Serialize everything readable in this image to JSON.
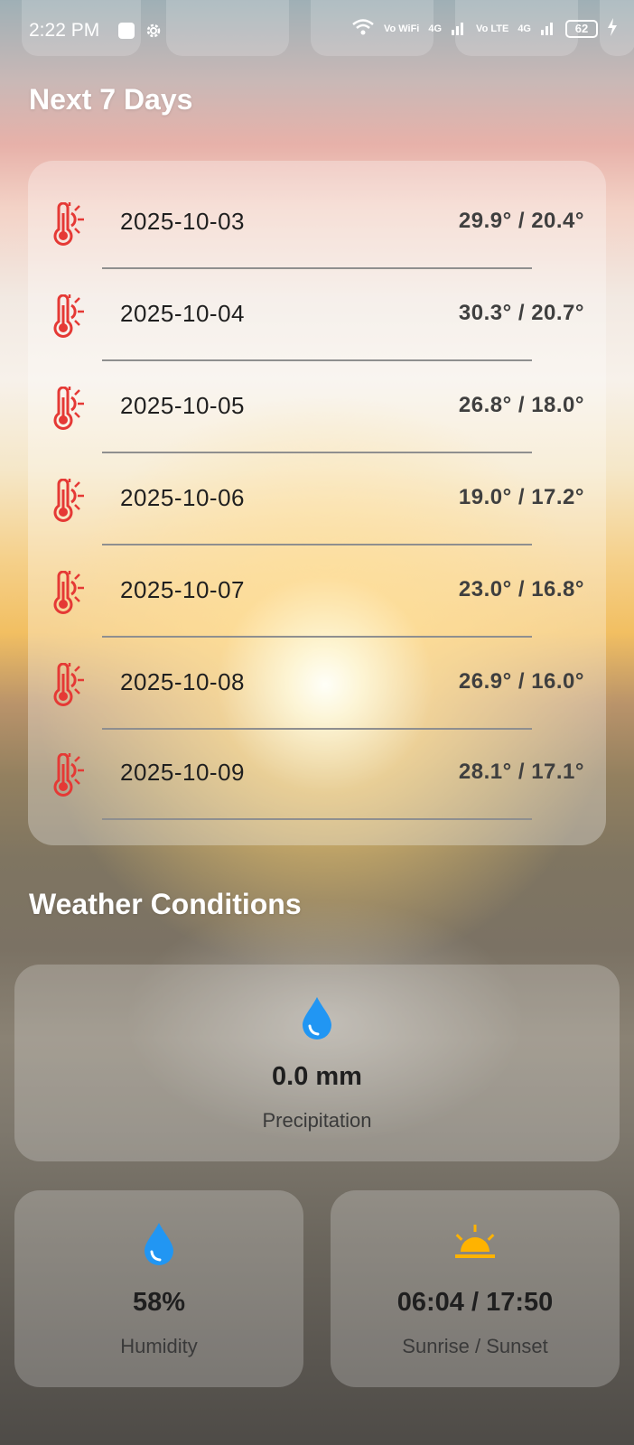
{
  "status_bar": {
    "time": "2:22 PM",
    "network_labels": [
      "Vo WiFi",
      "4G",
      "Vo LTE",
      "4G"
    ],
    "battery": "62"
  },
  "forecast": {
    "title": "Next 7 Days",
    "rows": [
      {
        "date": "2025-10-03",
        "temps": "29.9° / 20.4°"
      },
      {
        "date": "2025-10-04",
        "temps": "30.3° / 20.7°"
      },
      {
        "date": "2025-10-05",
        "temps": "26.8° / 18.0°"
      },
      {
        "date": "2025-10-06",
        "temps": "19.0° / 17.2°"
      },
      {
        "date": "2025-10-07",
        "temps": "23.0° / 16.8°"
      },
      {
        "date": "2025-10-08",
        "temps": "26.9° / 16.0°"
      },
      {
        "date": "2025-10-09",
        "temps": "28.1° / 17.1°"
      }
    ],
    "icon": "thermometer-sun-icon",
    "icon_color": "#e53935"
  },
  "conditions": {
    "title": "Weather Conditions",
    "precipitation": {
      "value": "0.0 mm",
      "label": "Precipitation",
      "icon": "water-drop-icon",
      "color": "#2196f3"
    },
    "humidity": {
      "value": "58%",
      "label": "Humidity",
      "icon": "water-drop-icon",
      "color": "#2196f3"
    },
    "sun": {
      "value": "06:04 / 17:50",
      "label": "Sunrise / Sunset",
      "icon": "sunrise-icon",
      "color": "#ffb300"
    }
  }
}
